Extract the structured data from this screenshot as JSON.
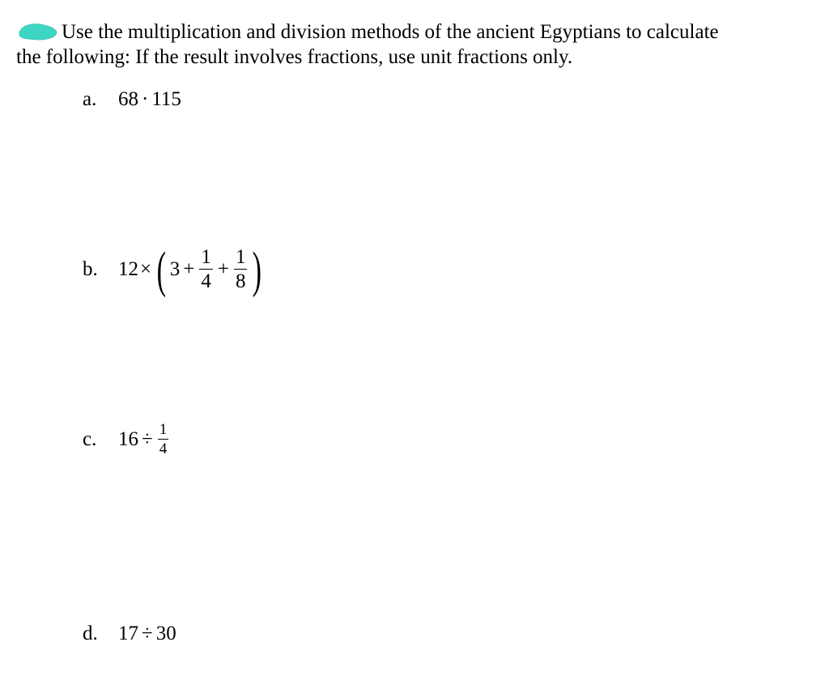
{
  "intro": {
    "line1": "Use the multiplication and division methods of the ancient Egyptians to calculate",
    "line2": "the following: If the result involves fractions, use unit fractions only."
  },
  "highlight_color": "#3fd5c5",
  "items": {
    "a": {
      "label": "a.",
      "expr_plain": "68 · 115",
      "lhs": "68",
      "op": "·",
      "rhs": "115"
    },
    "b": {
      "label": "b.",
      "lhs": "12",
      "times": "×",
      "inside_int": "3",
      "plus": "+",
      "f1_num": "1",
      "f1_den": "4",
      "f2_num": "1",
      "f2_den": "8"
    },
    "c": {
      "label": "c.",
      "lhs": "16",
      "op": "÷",
      "f_num": "1",
      "f_den": "4"
    },
    "d": {
      "label": "d.",
      "expr_plain": "17 ÷ 30",
      "lhs": "17",
      "op": "÷",
      "rhs": "30"
    }
  }
}
